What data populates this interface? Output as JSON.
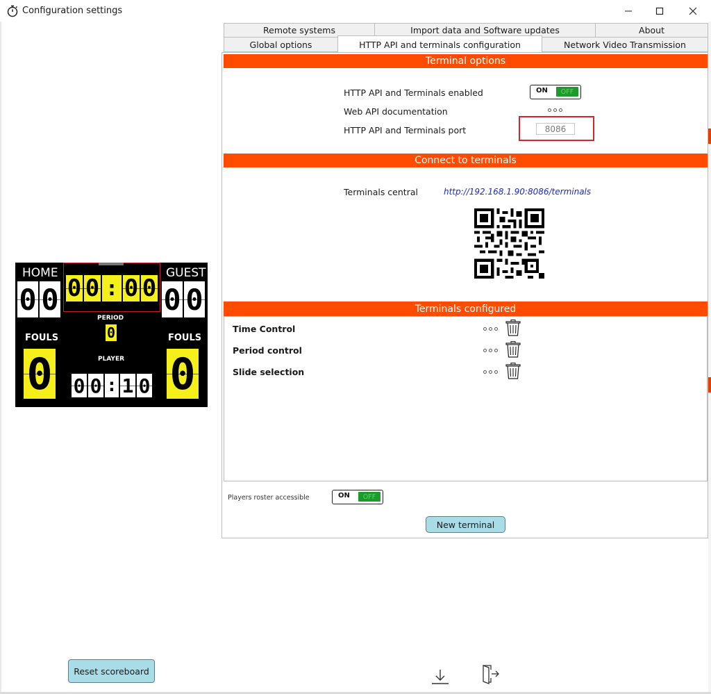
{
  "window": {
    "title": "Configuration settings"
  },
  "tabs": {
    "row1": [
      "Remote systems",
      "Import data and Software updates",
      "About"
    ],
    "row2": [
      "Global options",
      "HTTP API and terminals configuration",
      "Network Video Transmission"
    ],
    "active": "HTTP API and terminals configuration"
  },
  "terminal_options": {
    "header": "Terminal options",
    "api_enabled_label": "HTTP API and Terminals enabled",
    "web_api_doc_label": "Web API documentation",
    "port_label": "HTTP API and Terminals port",
    "port_value": "8086",
    "toggle_on": "ON",
    "toggle_off": "OFF"
  },
  "connect": {
    "header": "Connect to terminals",
    "central_label": "Terminals central",
    "central_url": "http://192.168.1.90:8086/terminals"
  },
  "configured": {
    "header": "Terminals configured",
    "items": [
      "Time Control",
      "Period control",
      "Slide selection"
    ]
  },
  "roster": {
    "label": "Players roster accessible",
    "toggle_on": "ON",
    "toggle_off": "OFF"
  },
  "buttons": {
    "new_terminal": "New terminal",
    "reset_scoreboard": "Reset scoreboard"
  },
  "scoreboard": {
    "home_label": "HOME",
    "guest_label": "GUEST",
    "home_score": [
      "0",
      "0"
    ],
    "guest_score": [
      "0",
      "0"
    ],
    "clock": [
      "0",
      "0",
      ":",
      "0",
      "0"
    ],
    "period_label": "PERIOD",
    "period_value": "0",
    "fouls_label": "FOULS",
    "home_fouls": "0",
    "guest_fouls": "0",
    "player_label": "PLAYER",
    "player_clock": [
      "0",
      "0",
      ":",
      "1",
      "0"
    ]
  },
  "colors": {
    "accent": "#ff4c00",
    "button": "#a8dde8",
    "toggle_green": "#1d9a2c",
    "highlight": "#d8232a",
    "scoreboard_yellow": "#f5ef1b"
  }
}
